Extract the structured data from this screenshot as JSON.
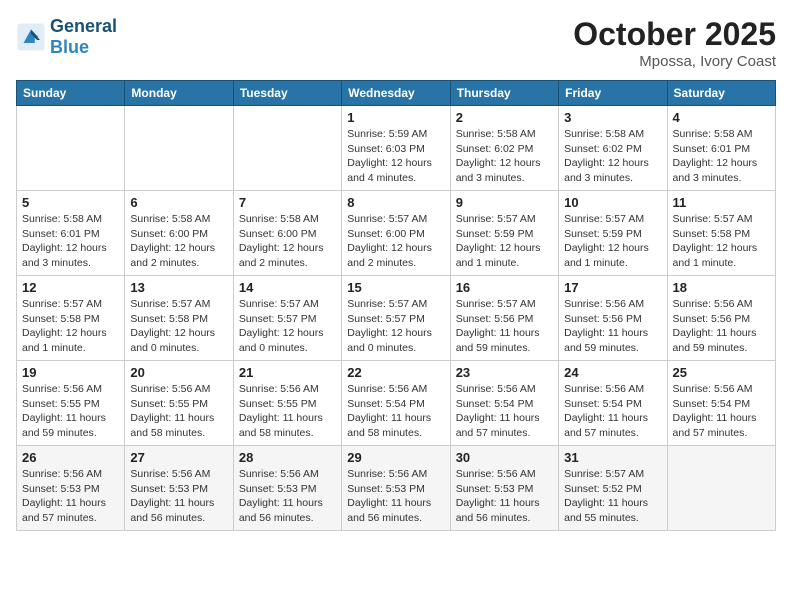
{
  "header": {
    "logo_general": "General",
    "logo_blue": "Blue",
    "month": "October 2025",
    "location": "Mpossa, Ivory Coast"
  },
  "weekdays": [
    "Sunday",
    "Monday",
    "Tuesday",
    "Wednesday",
    "Thursday",
    "Friday",
    "Saturday"
  ],
  "weeks": [
    [
      {
        "day": "",
        "info": ""
      },
      {
        "day": "",
        "info": ""
      },
      {
        "day": "",
        "info": ""
      },
      {
        "day": "1",
        "info": "Sunrise: 5:59 AM\nSunset: 6:03 PM\nDaylight: 12 hours and 4 minutes."
      },
      {
        "day": "2",
        "info": "Sunrise: 5:58 AM\nSunset: 6:02 PM\nDaylight: 12 hours and 3 minutes."
      },
      {
        "day": "3",
        "info": "Sunrise: 5:58 AM\nSunset: 6:02 PM\nDaylight: 12 hours and 3 minutes."
      },
      {
        "day": "4",
        "info": "Sunrise: 5:58 AM\nSunset: 6:01 PM\nDaylight: 12 hours and 3 minutes."
      }
    ],
    [
      {
        "day": "5",
        "info": "Sunrise: 5:58 AM\nSunset: 6:01 PM\nDaylight: 12 hours and 3 minutes."
      },
      {
        "day": "6",
        "info": "Sunrise: 5:58 AM\nSunset: 6:00 PM\nDaylight: 12 hours and 2 minutes."
      },
      {
        "day": "7",
        "info": "Sunrise: 5:58 AM\nSunset: 6:00 PM\nDaylight: 12 hours and 2 minutes."
      },
      {
        "day": "8",
        "info": "Sunrise: 5:57 AM\nSunset: 6:00 PM\nDaylight: 12 hours and 2 minutes."
      },
      {
        "day": "9",
        "info": "Sunrise: 5:57 AM\nSunset: 5:59 PM\nDaylight: 12 hours and 1 minute."
      },
      {
        "day": "10",
        "info": "Sunrise: 5:57 AM\nSunset: 5:59 PM\nDaylight: 12 hours and 1 minute."
      },
      {
        "day": "11",
        "info": "Sunrise: 5:57 AM\nSunset: 5:58 PM\nDaylight: 12 hours and 1 minute."
      }
    ],
    [
      {
        "day": "12",
        "info": "Sunrise: 5:57 AM\nSunset: 5:58 PM\nDaylight: 12 hours and 1 minute."
      },
      {
        "day": "13",
        "info": "Sunrise: 5:57 AM\nSunset: 5:58 PM\nDaylight: 12 hours and 0 minutes."
      },
      {
        "day": "14",
        "info": "Sunrise: 5:57 AM\nSunset: 5:57 PM\nDaylight: 12 hours and 0 minutes."
      },
      {
        "day": "15",
        "info": "Sunrise: 5:57 AM\nSunset: 5:57 PM\nDaylight: 12 hours and 0 minutes."
      },
      {
        "day": "16",
        "info": "Sunrise: 5:57 AM\nSunset: 5:56 PM\nDaylight: 11 hours and 59 minutes."
      },
      {
        "day": "17",
        "info": "Sunrise: 5:56 AM\nSunset: 5:56 PM\nDaylight: 11 hours and 59 minutes."
      },
      {
        "day": "18",
        "info": "Sunrise: 5:56 AM\nSunset: 5:56 PM\nDaylight: 11 hours and 59 minutes."
      }
    ],
    [
      {
        "day": "19",
        "info": "Sunrise: 5:56 AM\nSunset: 5:55 PM\nDaylight: 11 hours and 59 minutes."
      },
      {
        "day": "20",
        "info": "Sunrise: 5:56 AM\nSunset: 5:55 PM\nDaylight: 11 hours and 58 minutes."
      },
      {
        "day": "21",
        "info": "Sunrise: 5:56 AM\nSunset: 5:55 PM\nDaylight: 11 hours and 58 minutes."
      },
      {
        "day": "22",
        "info": "Sunrise: 5:56 AM\nSunset: 5:54 PM\nDaylight: 11 hours and 58 minutes."
      },
      {
        "day": "23",
        "info": "Sunrise: 5:56 AM\nSunset: 5:54 PM\nDaylight: 11 hours and 57 minutes."
      },
      {
        "day": "24",
        "info": "Sunrise: 5:56 AM\nSunset: 5:54 PM\nDaylight: 11 hours and 57 minutes."
      },
      {
        "day": "25",
        "info": "Sunrise: 5:56 AM\nSunset: 5:54 PM\nDaylight: 11 hours and 57 minutes."
      }
    ],
    [
      {
        "day": "26",
        "info": "Sunrise: 5:56 AM\nSunset: 5:53 PM\nDaylight: 11 hours and 57 minutes."
      },
      {
        "day": "27",
        "info": "Sunrise: 5:56 AM\nSunset: 5:53 PM\nDaylight: 11 hours and 56 minutes."
      },
      {
        "day": "28",
        "info": "Sunrise: 5:56 AM\nSunset: 5:53 PM\nDaylight: 11 hours and 56 minutes."
      },
      {
        "day": "29",
        "info": "Sunrise: 5:56 AM\nSunset: 5:53 PM\nDaylight: 11 hours and 56 minutes."
      },
      {
        "day": "30",
        "info": "Sunrise: 5:56 AM\nSunset: 5:53 PM\nDaylight: 11 hours and 56 minutes."
      },
      {
        "day": "31",
        "info": "Sunrise: 5:57 AM\nSunset: 5:52 PM\nDaylight: 11 hours and 55 minutes."
      },
      {
        "day": "",
        "info": ""
      }
    ]
  ]
}
